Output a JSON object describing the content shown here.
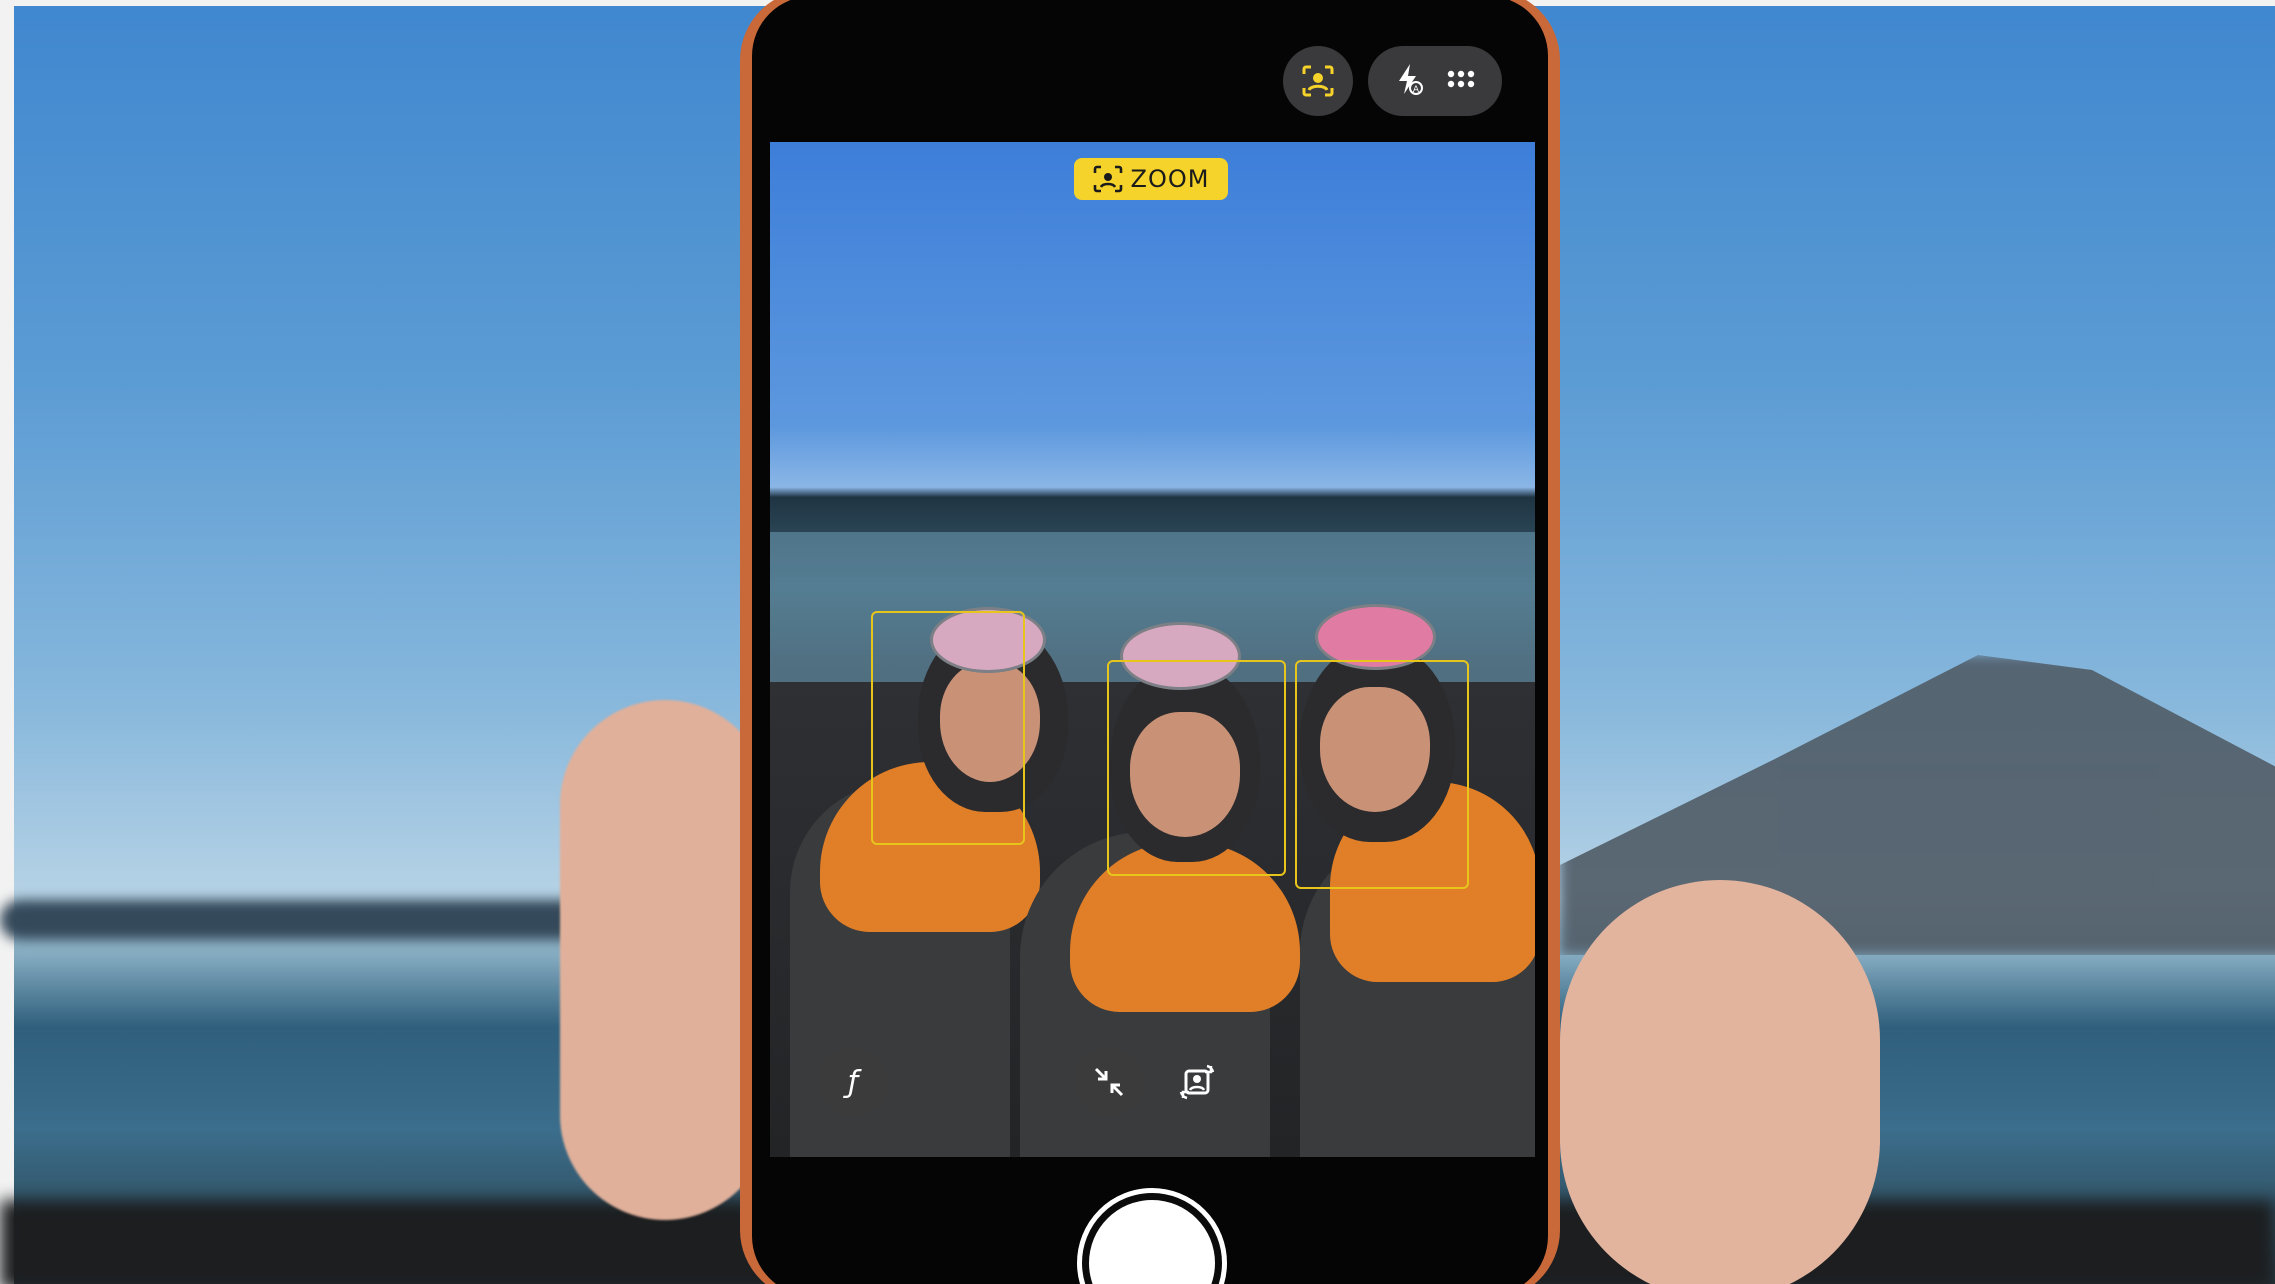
{
  "camera": {
    "zoom_badge": {
      "label": "ZOOM",
      "color": "#f5d32a"
    },
    "top_controls": [
      {
        "icon": "center-stage-icon",
        "color": "#f5d32a"
      },
      {
        "icon": "flash-auto-icon"
      },
      {
        "icon": "more-grid-icon"
      }
    ],
    "viewfinder_controls": {
      "aperture_glyph": "ƒ",
      "collapse_icon": "arrows-inward-icon",
      "rotate_icon": "rotate-portrait-icon"
    },
    "subject_focus_count": 3,
    "focus_color": "#e8c51b"
  },
  "device": {
    "body_color": "#c9693a"
  }
}
